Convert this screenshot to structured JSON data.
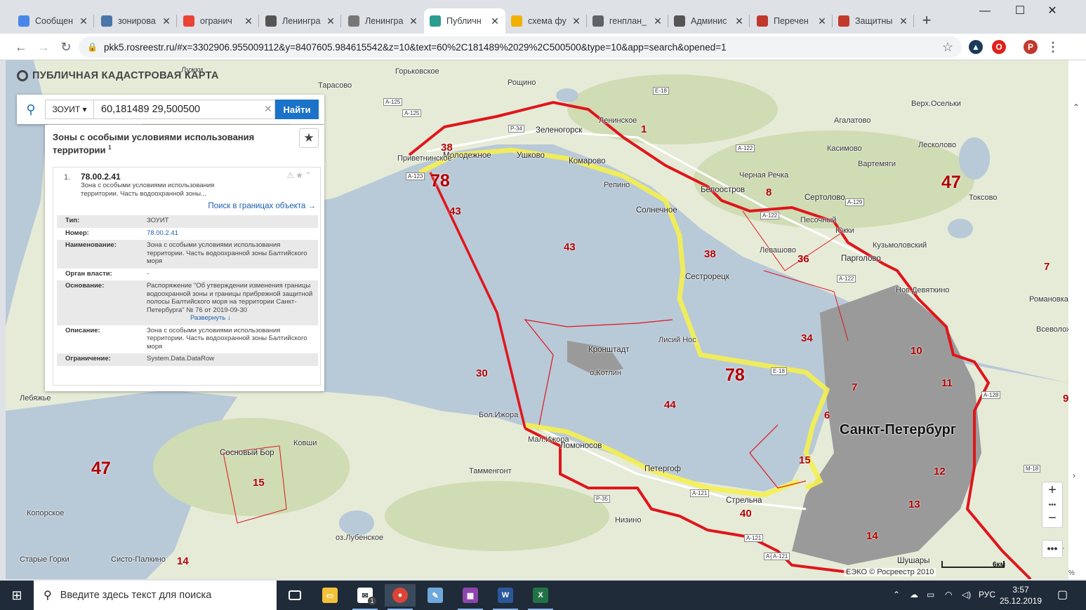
{
  "browser": {
    "tabs": [
      {
        "label": "Сообщен",
        "icon": "chat-icon",
        "color": "#4a86e8"
      },
      {
        "label": "зонирова",
        "icon": "vk-icon",
        "color": "#4a76a8"
      },
      {
        "label": "огранич",
        "icon": "google-icon",
        "color": "#ea4335"
      },
      {
        "label": "Ленингра",
        "icon": "wikipedia-icon",
        "color": "#555555"
      },
      {
        "label": "Ленингра",
        "icon": "diagram-icon",
        "color": "#777777"
      },
      {
        "label": "Публичн",
        "icon": "pkk-icon",
        "color": "#2a9d8f"
      },
      {
        "label": "схема фу",
        "icon": "image-icon",
        "color": "#f2b100"
      },
      {
        "label": "генплан_",
        "icon": "globe-icon",
        "color": "#5f6368"
      },
      {
        "label": "Админис",
        "icon": "wikipedia-icon",
        "color": "#555555"
      },
      {
        "label": "Перечен",
        "icon": "pdf-icon",
        "color": "#c0392b"
      },
      {
        "label": "Защитны",
        "icon": "pdf-icon",
        "color": "#c0392b"
      }
    ],
    "active_tab": 5,
    "url": "pkk5.rosreestr.ru/#x=3302906.955009112&y=8407605.984615542&z=10&text=60%2C181489%2029%2C500500&type=10&app=search&opened=1",
    "profile_initial": "P"
  },
  "app": {
    "title": "ПУБЛИЧНАЯ КАДАСТРОВАЯ КАРТА",
    "search": {
      "type": "ЗОУИТ",
      "query": "60,181489 29,500500",
      "button": "Найти"
    },
    "panel": {
      "heading": "Зоны с особыми условиями использования территории",
      "heading_sup": "1",
      "result": {
        "index": "1.",
        "id": "78.00.2.41",
        "desc": "Зона с особыми условиями использования территории. Часть водоохранной зоны...",
        "link": "Поиск в границах объекта →"
      },
      "props": [
        {
          "k": "Тип:",
          "v": "ЗОУИТ"
        },
        {
          "k": "Номер:",
          "v": "78.00.2.41",
          "link": true
        },
        {
          "k": "Наименование:",
          "v": "Зона с особыми условиями использования территории. Часть водоохранной зоны Балтийского моря"
        },
        {
          "k": "Орган власти:",
          "v": "-"
        },
        {
          "k": "Основание:",
          "v": "Распоряжение \"Об утверждении изменения границы водоохранной зоны и границы прибрежной защитной полосы Балтийского моря на территории Санкт-Петербурга\" № 76 от 2019-09-30",
          "more": "Развернуть ↓"
        },
        {
          "k": "Описание:",
          "v": "Зона с особыми условиями использования территории. Часть водоохранной зоны Балтийского моря"
        },
        {
          "k": "Ограничение:",
          "v": "System.Data.DataRow"
        }
      ]
    },
    "map": {
      "places": [
        "Лужки",
        "Горьковское",
        "Тарасово",
        "Рощино",
        "Зеленогорск",
        "Ленинское",
        "Молодежное",
        "Ушково",
        "Комарово",
        "Репино",
        "Приветнинское",
        "Белоостров",
        "Черная Речка",
        "Сертолово",
        "Песочный",
        "Юкки",
        "Левашово",
        "Парголово",
        "Кузьмоловский",
        "Солнечное",
        "Сестрорецк",
        "Лисий Нос",
        "Кронштадт",
        "о.Котлин",
        "Бол.Ижора",
        "Мал.Ижора",
        "Ломоносов",
        "Петергоф",
        "Стрельна",
        "Низино",
        "Шушары",
        "Сосновый Бор",
        "Ковши",
        "Лебяжье",
        "оз.Лубенское",
        "Копорское",
        "Агалатово",
        "Касимово",
        "Вартемяги",
        "Верх.Осельки",
        "Лесколово",
        "Токсово",
        "Нов.Девяткино",
        "Романовка",
        "Всеволожск",
        "Усть-",
        "Старые Горки",
        "Систо-Палкино",
        "Тамменгонт"
      ],
      "city": "Санкт-Петербург",
      "zones": [
        "38",
        "78",
        "43",
        "43",
        "1",
        "8",
        "47",
        "38",
        "36",
        "7",
        "34",
        "10",
        "78",
        "11",
        "30",
        "44",
        "7",
        "6",
        "12",
        "15",
        "13",
        "14",
        "47",
        "15",
        "14",
        "40",
        "9"
      ],
      "roads": [
        "А-125",
        "А-125",
        "Е-18",
        "Р-34",
        "А-122",
        "А-122",
        "А-123",
        "А-129",
        "А-122",
        "Е-18",
        "А-121",
        "А-121",
        "А-121",
        "Р-35",
        "А-128",
        "М-18",
        "А-121"
      ],
      "scale": "6км",
      "copyright": "ЕЭКО © Росреестр 2010",
      "zoom_pct": "%"
    }
  },
  "taskbar": {
    "search_placeholder": "Введите здесь текст для поиска",
    "lang": "РУС",
    "time": "3:57",
    "date": "25.12.2019",
    "mail_badge": "1"
  },
  "colors": {
    "boundary": "#e0151b",
    "water_zone": "#f5f050",
    "sea": "#b8c9d8",
    "land": "#e6ebd8",
    "forest": "#cfdcb4",
    "urban": "#8d8d8d"
  }
}
